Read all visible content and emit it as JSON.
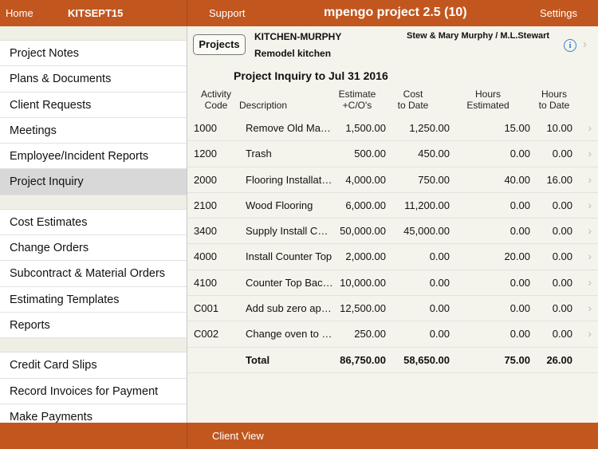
{
  "topbar": {
    "home": "Home",
    "job_code": "KITSEPT15",
    "support": "Support",
    "title": "mpengo project 2.5 (10)",
    "settings": "Settings"
  },
  "sidebar": {
    "group1": [
      "Project Notes",
      "Plans & Documents",
      "Client Requests",
      "Meetings",
      "Employee/Incident Reports",
      "Project Inquiry"
    ],
    "group2": [
      "Cost Estimates",
      "Change Orders",
      "Subcontract & Material Orders",
      "Estimating Templates",
      "Reports"
    ],
    "group3": [
      "Credit Card Slips",
      "Record Invoices for Payment",
      "Make Payments"
    ],
    "selected": "Project Inquiry"
  },
  "project": {
    "button": "Projects",
    "name": "KITCHEN-MURPHY",
    "description": "Remodel kitchen",
    "client": "Stew & Mary Murphy / M.L.Stewart",
    "info_icon": "info-icon"
  },
  "report": {
    "title": "Project Inquiry to Jul 31 2016",
    "headers": {
      "code": [
        "Activity",
        "Code"
      ],
      "description": "Description",
      "estimate": [
        "Estimate",
        "+C/O's"
      ],
      "cost": [
        "Cost",
        "to Date"
      ],
      "hours_est": [
        "Hours",
        "Estimated"
      ],
      "hours_date": [
        "Hours",
        "to Date"
      ]
    },
    "rows": [
      {
        "code": "1000",
        "desc": "Remove Old Mate…",
        "est": "1,500.00",
        "cost": "1,250.00",
        "he": "15.00",
        "hd": "10.00"
      },
      {
        "code": "1200",
        "desc": "Trash",
        "est": "500.00",
        "cost": "450.00",
        "he": "0.00",
        "hd": "0.00"
      },
      {
        "code": "2000",
        "desc": "Flooring Installation",
        "est": "4,000.00",
        "cost": "750.00",
        "he": "40.00",
        "hd": "16.00"
      },
      {
        "code": "2100",
        "desc": "Wood Flooring",
        "est": "6,000.00",
        "cost": "11,200.00",
        "he": "0.00",
        "hd": "0.00"
      },
      {
        "code": "3400",
        "desc": "Supply Install Cus…",
        "est": "50,000.00",
        "cost": "45,000.00",
        "he": "0.00",
        "hd": "0.00"
      },
      {
        "code": "4000",
        "desc": "Install Counter Top",
        "est": "2,000.00",
        "cost": "0.00",
        "he": "20.00",
        "hd": "0.00"
      },
      {
        "code": "4100",
        "desc": "Counter Top Bac…",
        "est": "10,000.00",
        "cost": "0.00",
        "he": "0.00",
        "hd": "0.00"
      },
      {
        "code": "C001",
        "desc": "Add sub zero app…",
        "est": "12,500.00",
        "cost": "0.00",
        "he": "0.00",
        "hd": "0.00"
      },
      {
        "code": "C002",
        "desc": "Change oven to n…",
        "est": "250.00",
        "cost": "0.00",
        "he": "0.00",
        "hd": "0.00"
      }
    ],
    "total": {
      "label": "Total",
      "est": "86,750.00",
      "cost": "58,650.00",
      "he": "75.00",
      "hd": "26.00"
    }
  },
  "bottombar": {
    "client_view": "Client View"
  },
  "colors": {
    "bar": "#c1571f",
    "selected_item": "#d8d8d8",
    "info_icon": "#3a7fd5"
  }
}
